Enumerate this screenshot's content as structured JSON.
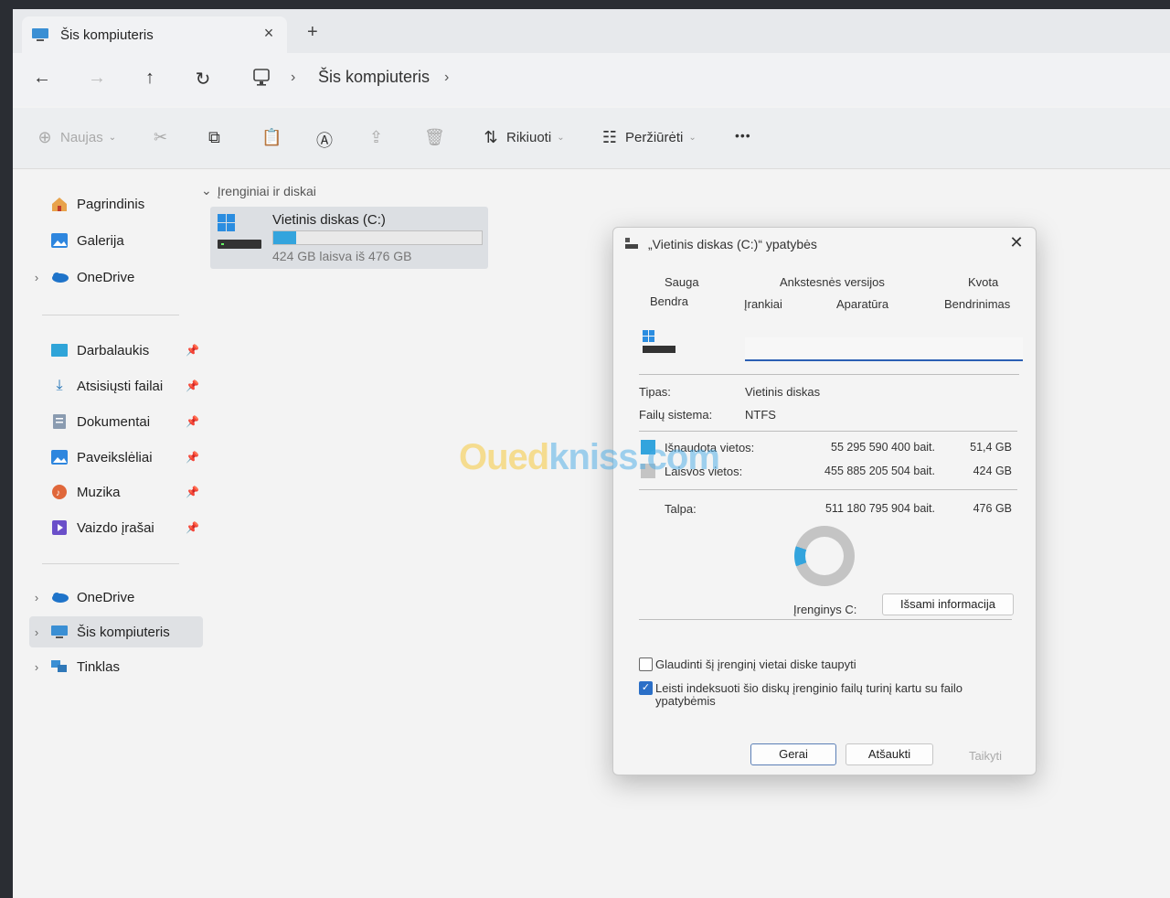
{
  "window": {
    "tab_title": "Šis kompiuteris",
    "tab_close": "×",
    "new_tab": "+"
  },
  "nav": {
    "back": "←",
    "forward": "→",
    "up": "↑",
    "refresh": "↻",
    "breadcrumb_sep": "›",
    "breadcrumb": "Šis kompiuteris"
  },
  "commands": {
    "new_label": "Naujas",
    "sort_label": "Rikiuoti",
    "view_label": "Peržiūrėti",
    "more": "•••"
  },
  "sidebar": {
    "items": [
      {
        "label": "Pagrindinis"
      },
      {
        "label": "Galerija"
      },
      {
        "label": "OneDrive"
      },
      {
        "label": "Darbalaukis"
      },
      {
        "label": "Atsisiųsti failai"
      },
      {
        "label": "Dokumentai"
      },
      {
        "label": "Paveikslėliai"
      },
      {
        "label": "Muzika"
      },
      {
        "label": "Vaizdo įrašai"
      },
      {
        "label": "OneDrive"
      },
      {
        "label": "Šis kompiuteris"
      },
      {
        "label": "Tinklas"
      }
    ]
  },
  "content": {
    "group_header": "Įrenginiai ir diskai",
    "drive": {
      "name": "Vietinis diskas (C:)",
      "free_text": "424 GB laisva iš 476 GB",
      "used_fraction": 0.108
    }
  },
  "dialog": {
    "title": "„Vietinis diskas (C:)“ ypatybės",
    "close": "✕",
    "tabs_row1": [
      "Sauga",
      "Ankstesnės versijos",
      "Kvota"
    ],
    "tabs_row2": [
      "Bendra",
      "Įrankiai",
      "Aparatūra",
      "Bendrinimas"
    ],
    "name_value": "",
    "type_label": "Tipas:",
    "type_value": "Vietinis diskas",
    "fs_label": "Failų sistema:",
    "fs_value": "NTFS",
    "used_label": "Išnaudota vietos:",
    "used_bytes": "55 295 590 400 bait.",
    "used_size": "51,4 GB",
    "free_label": "Laisvos vietos:",
    "free_bytes": "455 885 205 504 bait.",
    "free_size": "424 GB",
    "cap_label": "Talpa:",
    "cap_bytes": "511 180 795 904 bait.",
    "cap_size": "476 GB",
    "used_fraction": 0.108,
    "device_label": "Įrenginys C:",
    "details_btn": "Išsami informacija",
    "compress_label": "Glaudinti šį įrenginį vietai diske taupyti",
    "compress_checked": false,
    "index_label": "Leisti indeksuoti šio diskų įrenginio failų turinį kartu su failo ypatybėmis",
    "index_checked": true,
    "ok_btn": "Gerai",
    "cancel_btn": "Atšaukti",
    "apply_btn": "Taikyti",
    "used_color": "#33a4dd",
    "free_color": "#c4c4c4"
  },
  "watermark": {
    "part1": "Oued",
    "part2": "kniss.com"
  }
}
